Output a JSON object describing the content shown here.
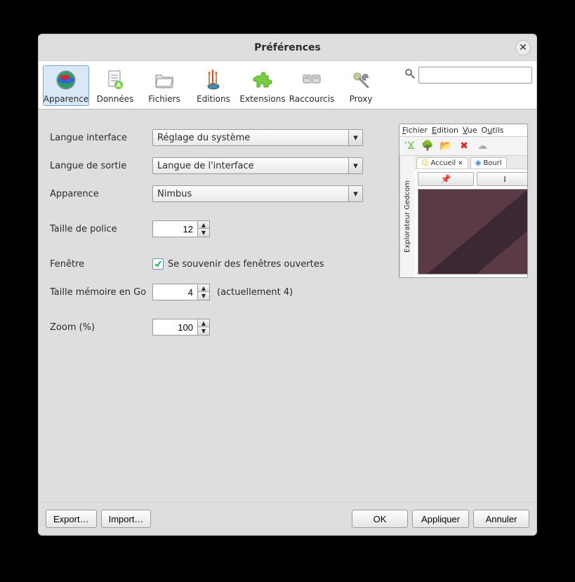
{
  "window": {
    "title": "Préférences"
  },
  "toolbar": {
    "items": [
      {
        "id": "apparence",
        "label": "Apparence",
        "icon": "globe-icon"
      },
      {
        "id": "donnees",
        "label": "Données",
        "icon": "document-icon"
      },
      {
        "id": "fichiers",
        "label": "Fichiers",
        "icon": "folder-icon"
      },
      {
        "id": "editions",
        "label": "Editions",
        "icon": "brushes-icon"
      },
      {
        "id": "extensions",
        "label": "Extensions",
        "icon": "puzzle-icon"
      },
      {
        "id": "raccourcis",
        "label": "Raccourcis",
        "icon": "keyboard-icon"
      },
      {
        "id": "proxy",
        "label": "Proxy",
        "icon": "wrench-icon"
      }
    ],
    "selected": 0
  },
  "search": {
    "value": ""
  },
  "form": {
    "langue_interface": {
      "label": "Langue interface",
      "value": "Réglage du système"
    },
    "langue_sortie": {
      "label": "Langue de sortie",
      "value": "Langue de l'interface"
    },
    "apparence": {
      "label": "Apparence",
      "value": "Nimbus"
    },
    "taille_police": {
      "label": "Taille de police",
      "value": "12"
    },
    "fenetre": {
      "label": "Fenêtre",
      "checkbox_label": "Se souvenir des fenêtres ouvertes",
      "checked": true
    },
    "taille_memoire": {
      "label": "Taille mémoire en Go",
      "value": "4",
      "note": "(actuellement 4)"
    },
    "zoom": {
      "label": "Zoom (%)",
      "value": "100"
    }
  },
  "preview": {
    "menubar": [
      "Fichier",
      "Edition",
      "Vue",
      "Outils"
    ],
    "side_tab": "Explorateur Gedcom",
    "tabs": [
      {
        "icon": "smile-icon",
        "label": "Accueil",
        "closable": true
      },
      {
        "icon": "people-icon",
        "label": "Bourl",
        "closable": false
      }
    ]
  },
  "footer": {
    "export": "Export…",
    "import": "Import…",
    "ok": "OK",
    "apply": "Appliquer",
    "cancel": "Annuler"
  }
}
